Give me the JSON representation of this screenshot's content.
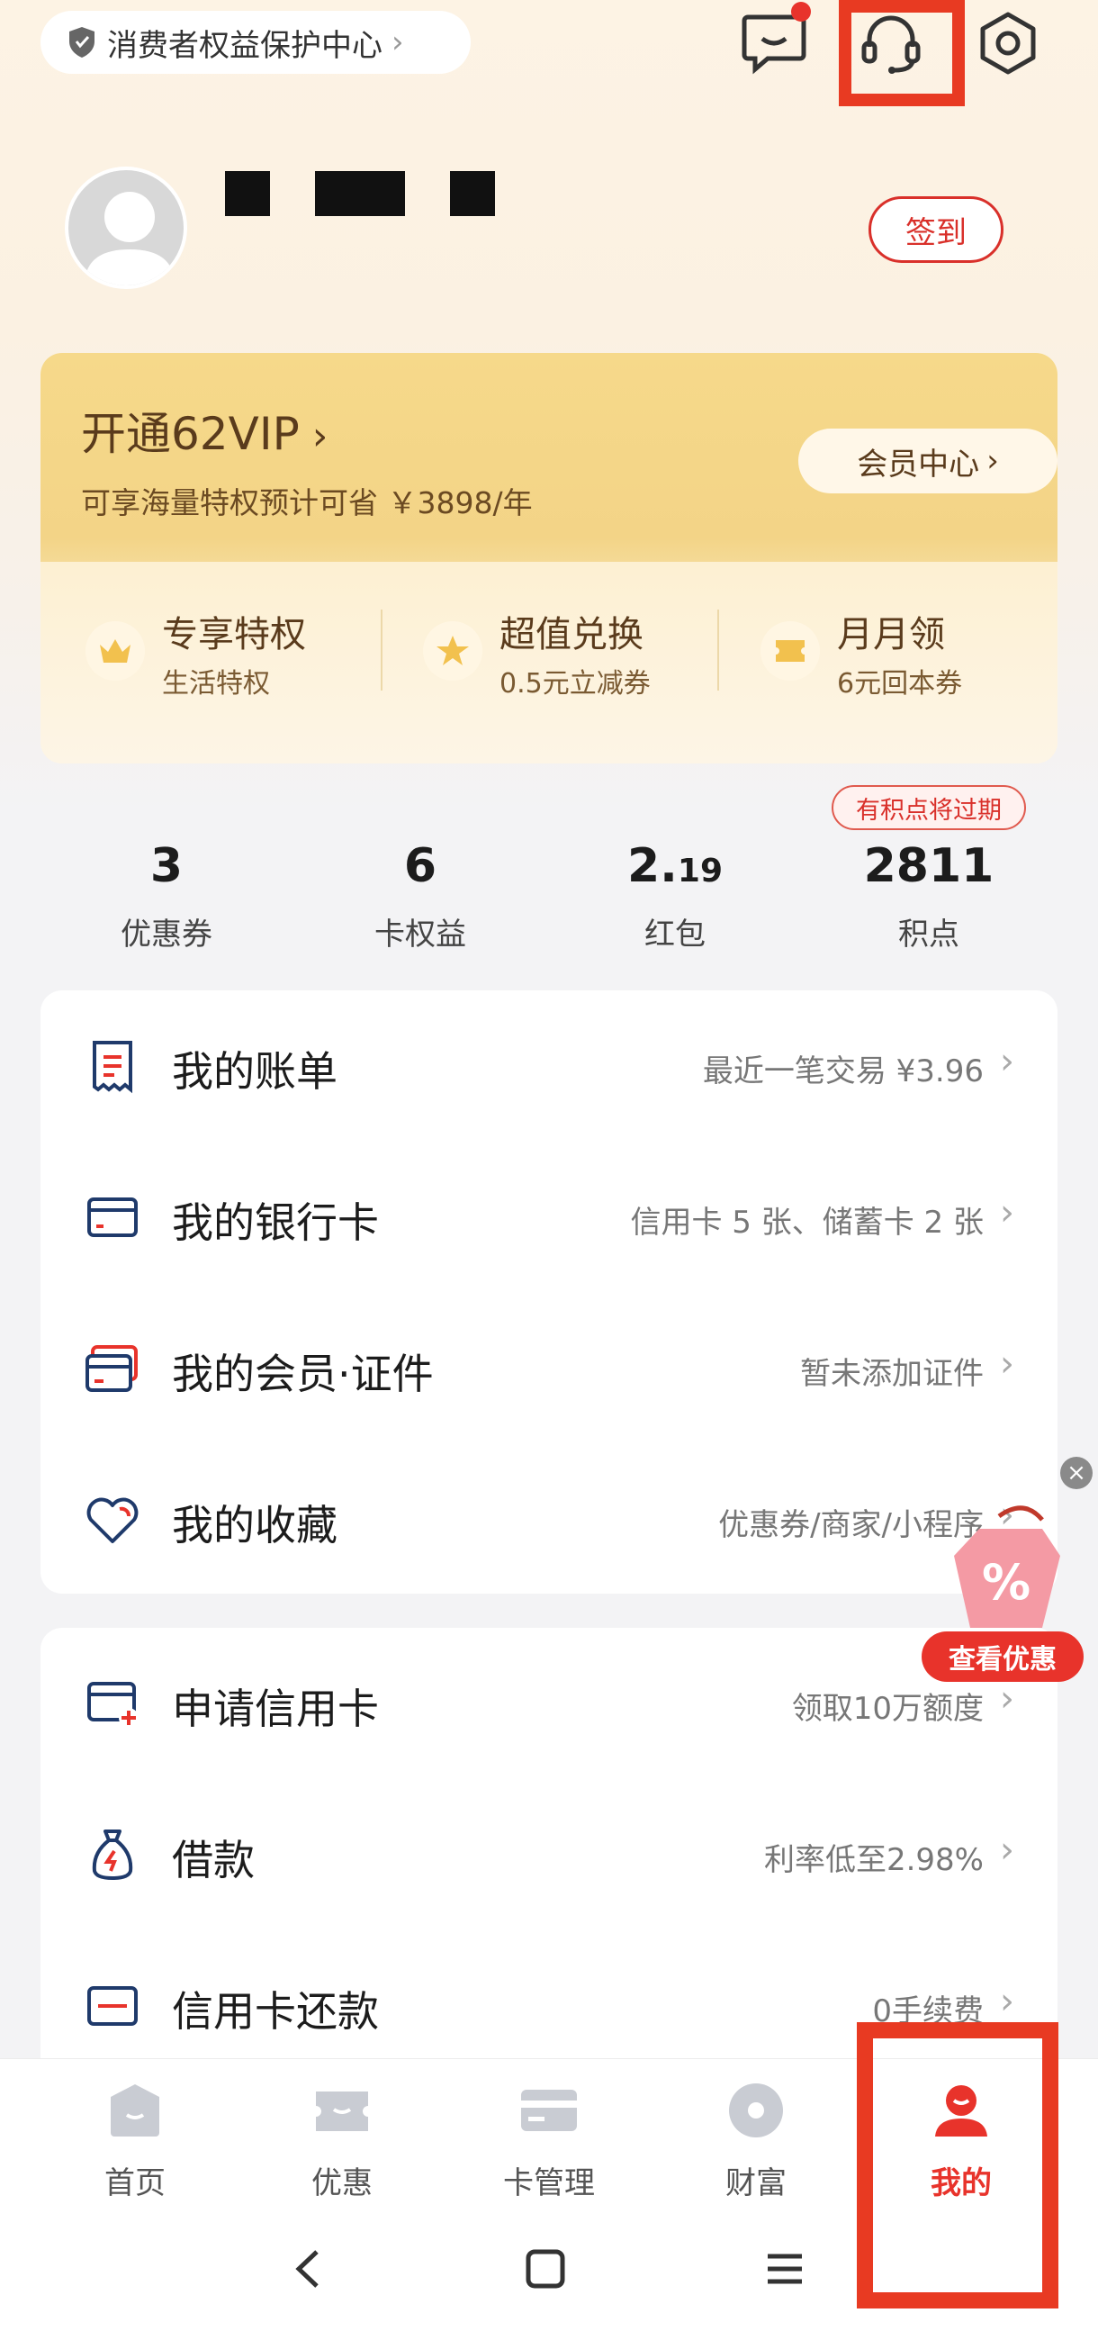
{
  "topbar": {
    "protection_center": "消费者权益保护中心",
    "icons": [
      "shield-icon",
      "message-icon",
      "customer-service-icon",
      "settings-icon"
    ]
  },
  "profile": {
    "sign_in_label": "签到"
  },
  "vip": {
    "title": "开通62VIP",
    "subtitle": "可享海量特权预计可省 ￥3898/年",
    "member_center_label": "会员中心",
    "perks": [
      {
        "title": "专享特权",
        "desc": "生活特权",
        "icon": "crown-icon"
      },
      {
        "title": "超值兑换",
        "desc": "0.5元立减券",
        "icon": "star-icon"
      },
      {
        "title": "月月领",
        "desc": "6元回本券",
        "icon": "ticket-icon"
      }
    ]
  },
  "stats": {
    "expire_notice": "有积点将过期",
    "items": [
      {
        "value": "3",
        "label": "优惠券"
      },
      {
        "value": "6",
        "label": "卡权益"
      },
      {
        "value_int": "2.",
        "value_dec": "19",
        "label": "红包"
      },
      {
        "value": "2811",
        "label": "积点"
      }
    ]
  },
  "menu_group_1": [
    {
      "label": "我的账单",
      "hint": "最近一笔交易 ¥3.96",
      "icon": "bill-icon"
    },
    {
      "label": "我的银行卡",
      "hint": "信用卡 5 张、储蓄卡 2 张",
      "icon": "bank-card-icon"
    },
    {
      "label": "我的会员·证件",
      "hint": "暂未添加证件",
      "icon": "membership-card-icon"
    },
    {
      "label": "我的收藏",
      "hint": "优惠券/商家/小程序",
      "icon": "heart-icon"
    }
  ],
  "menu_group_2": [
    {
      "label": "申请信用卡",
      "hint": "领取10万额度",
      "icon": "apply-card-icon"
    },
    {
      "label": "借款",
      "hint": "利率低至2.98%",
      "icon": "money-bag-icon"
    },
    {
      "label": "信用卡还款",
      "hint": "0手续费",
      "icon": "repay-card-icon"
    }
  ],
  "promo": {
    "button_label": "查看优惠"
  },
  "bottom_nav": [
    {
      "label": "首页",
      "active": false
    },
    {
      "label": "优惠",
      "active": false
    },
    {
      "label": "卡管理",
      "active": false
    },
    {
      "label": "财富",
      "active": false
    },
    {
      "label": "我的",
      "active": true
    }
  ],
  "colors": {
    "accent_red": "#e8332b",
    "vip_gold": "#f3d487",
    "vip_text": "#5a3b1c",
    "highlight_box": "#e83a22"
  }
}
